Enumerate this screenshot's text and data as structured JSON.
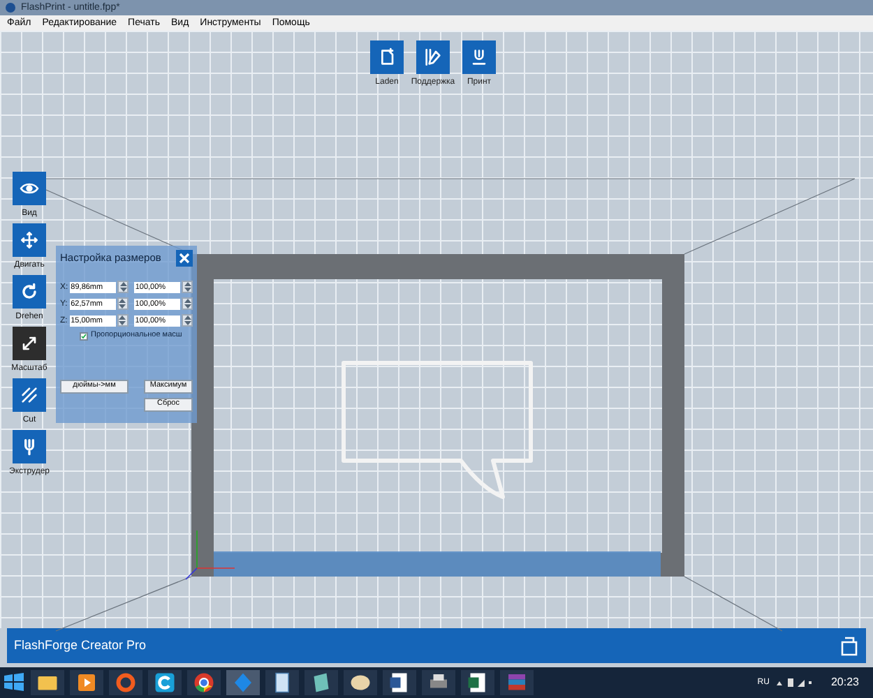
{
  "window": {
    "title": "FlashPrint - untitle.fpp*"
  },
  "menu": [
    "Файл",
    "Редактирование",
    "Печать",
    "Вид",
    "Инструменты",
    "Помощь"
  ],
  "top_toolbar": [
    {
      "kind": "load",
      "label": "Laden"
    },
    {
      "kind": "support",
      "label": "Поддержка"
    },
    {
      "kind": "print",
      "label": "Принт"
    }
  ],
  "left_toolbar": [
    {
      "kind": "view",
      "label": "Вид",
      "selected": false
    },
    {
      "kind": "move",
      "label": "Двигать",
      "selected": false
    },
    {
      "kind": "rotate",
      "label": "Drehen",
      "selected": false
    },
    {
      "kind": "scale",
      "label": "Масштаб",
      "selected": true
    },
    {
      "kind": "cut",
      "label": "Cut",
      "selected": false
    },
    {
      "kind": "extruder",
      "label": "Экструдер",
      "selected": false
    }
  ],
  "scale_panel": {
    "title": "Настройка размеров",
    "rows": [
      {
        "axis": "X:",
        "size": "89,86mm",
        "percent": "100,00%"
      },
      {
        "axis": "Y:",
        "size": "62,57mm",
        "percent": "100,00%"
      },
      {
        "axis": "Z:",
        "size": "15,00mm",
        "percent": "100,00%"
      }
    ],
    "proportional": {
      "label": "Пропорциональное масш",
      "checked": true
    },
    "buttons": [
      "дюймы->мм",
      "Максимум",
      "Сброс"
    ]
  },
  "status_bar": {
    "printer": "FlashForge Creator Pro"
  },
  "taskbar": {
    "language": "RU",
    "time": "20:23"
  }
}
